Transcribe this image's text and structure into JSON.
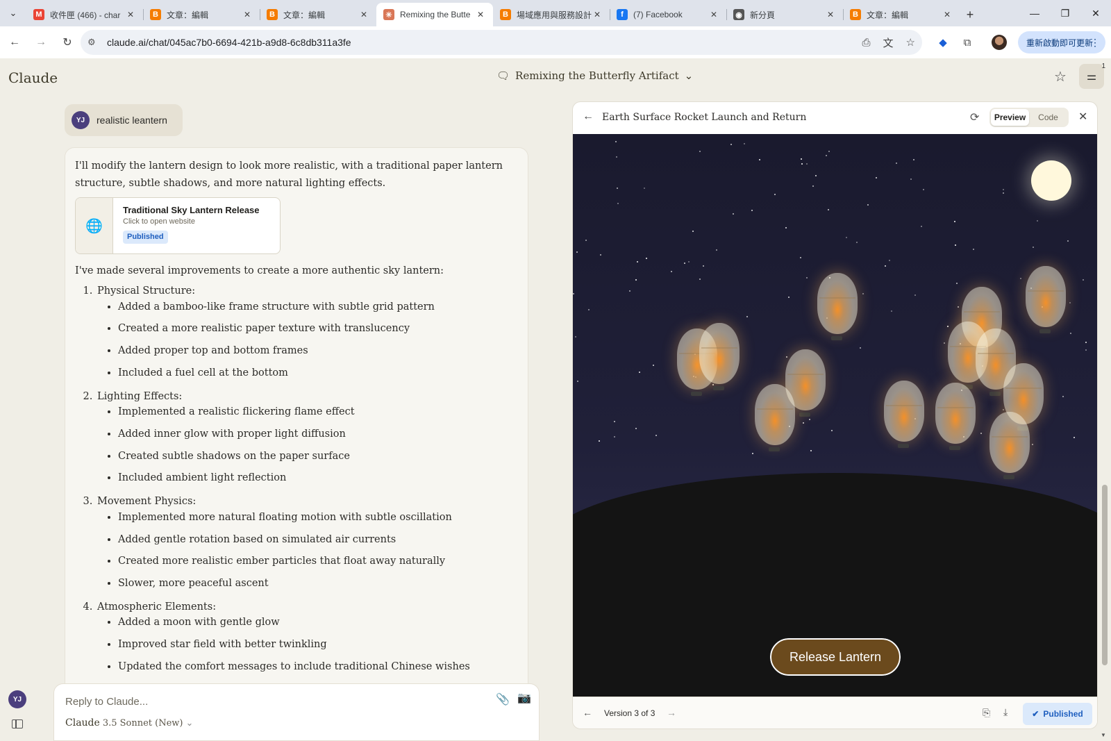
{
  "browser": {
    "tabs": [
      {
        "title": "收件匣 (466) - char",
        "favicon": "gmail-icon",
        "favicon_text": "M",
        "favicon_color": "#ea4335",
        "active": false
      },
      {
        "title": "文章：編輯",
        "favicon": "blogger-icon",
        "favicon_text": "B",
        "favicon_color": "#f57c00",
        "active": false
      },
      {
        "title": "文章：編輯",
        "favicon": "blogger-icon",
        "favicon_text": "B",
        "favicon_color": "#f57c00",
        "active": false
      },
      {
        "title": "Remixing the Butte",
        "favicon": "claude-icon",
        "favicon_text": "✳",
        "favicon_color": "#d97757",
        "active": true
      },
      {
        "title": "場域應用與服務設計",
        "favicon": "blogger-icon",
        "favicon_text": "B",
        "favicon_color": "#f57c00",
        "active": false
      },
      {
        "title": "(7) Facebook",
        "favicon": "facebook-icon",
        "favicon_text": "f",
        "favicon_color": "#1877f2",
        "active": false
      },
      {
        "title": "新分頁",
        "favicon": "chrome-icon",
        "favicon_text": "◉",
        "favicon_color": "#555555",
        "active": false
      },
      {
        "title": "文章：編輯",
        "favicon": "blogger-icon",
        "favicon_text": "B",
        "favicon_color": "#f57c00",
        "active": false
      }
    ],
    "url": "claude.ai/chat/045ac7b0-6694-421b-a9d8-6c8db311a3fe",
    "update_button": "重新啟動即可更新"
  },
  "app": {
    "logo": "Claude",
    "chat_title": "Remixing the Butterfly Artifact",
    "settings_badge": "1"
  },
  "user_message": {
    "avatar": "YJ",
    "text": "realistic leantern"
  },
  "assistant_message": {
    "intro": "I'll modify the lantern design to look more realistic, with a traditional paper lantern structure, subtle shadows, and more natural lighting effects.",
    "artifact": {
      "name": "Traditional Sky Lantern Release",
      "subtitle": "Click to open website",
      "badge": "Published"
    },
    "summary": "I've made several improvements to create a more authentic sky lantern:",
    "sections": [
      {
        "title": "Physical Structure:",
        "items": [
          "Added a bamboo-like frame structure with subtle grid pattern",
          "Created a more realistic paper texture with translucency",
          "Added proper top and bottom frames",
          "Included a fuel cell at the bottom"
        ]
      },
      {
        "title": "Lighting Effects:",
        "items": [
          "Implemented a realistic flickering flame effect",
          "Added inner glow with proper light diffusion",
          "Created subtle shadows on the paper surface",
          "Included ambient light reflection"
        ]
      },
      {
        "title": "Movement Physics:",
        "items": [
          "Implemented more natural floating motion with subtle oscillation",
          "Added gentle rotation based on simulated air currents",
          "Created more realistic ember particles that float away naturally",
          "Slower, more peaceful ascent"
        ]
      },
      {
        "title": "Atmospheric Elements:",
        "items": [
          "Added a moon with gentle glow",
          "Improved star field with better twinkling",
          "Updated the comfort messages to include traditional Chinese wishes"
        ]
      }
    ]
  },
  "composer": {
    "placeholder": "Reply to Claude...",
    "model_brand": "Claude",
    "model_version": "3.5 Sonnet (New)",
    "user_avatar": "YJ"
  },
  "artifact_panel": {
    "title": "Earth Surface Rocket Launch and Return",
    "tabs": {
      "preview": "Preview",
      "code": "Code"
    },
    "active_tab": "preview",
    "release_button": "Release Lantern",
    "version_label": "Version 3 of 3",
    "published_label": "Published",
    "lantern_count": 13,
    "colors": {
      "sky": "#1a1a2e",
      "ground": "#141414",
      "button": "#6b4a1d",
      "moon": "#fff8dc"
    }
  }
}
